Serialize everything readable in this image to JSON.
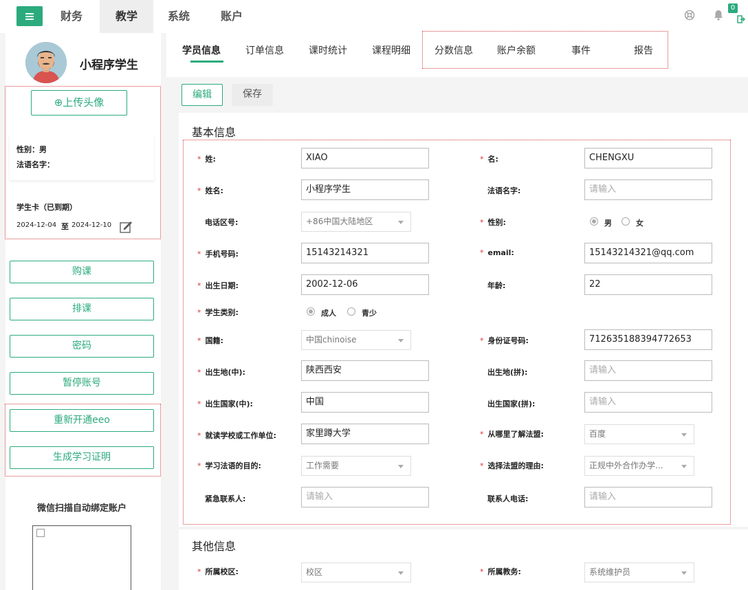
{
  "nav": {
    "items": [
      "财务",
      "教学",
      "系统",
      "账户"
    ],
    "active": "教学",
    "badge_count": "0"
  },
  "student": {
    "name": "小程序学生"
  },
  "sidebar": {
    "upload_label": "⊕上传头像",
    "gender_line": "性别：男",
    "french_name_line": "法语名字：",
    "card_title": "学生卡（已到期）",
    "card_start": "2024-12-04",
    "card_to": "至",
    "card_end": "2024-12-10",
    "buttons": [
      "购课",
      "排课",
      "密码",
      "暂停账号",
      "重新开通eeo",
      "生成学习证明"
    ],
    "wechat_title": "微信扫描自动绑定账户"
  },
  "tabs": [
    "学员信息",
    "订单信息",
    "课时统计",
    "课程明细",
    "分数信息",
    "账户余额",
    "事件",
    "报告"
  ],
  "actions": {
    "edit": "编辑",
    "save": "保存"
  },
  "basic": {
    "title": "基本信息",
    "fields": {
      "last_name": {
        "label": "姓:",
        "value": "XIAO"
      },
      "first_name": {
        "label": "名:",
        "value": "CHENGXU"
      },
      "full_name": {
        "label": "姓名:",
        "value": "小程序学生"
      },
      "french_name": {
        "label": "法语名字:",
        "placeholder": "请输入"
      },
      "phone_code": {
        "label": "电话区号:",
        "value": "+86中国大陆地区"
      },
      "gender": {
        "label": "性别:",
        "opt_male": "男",
        "opt_female": "女"
      },
      "mobile": {
        "label": "手机号码:",
        "value": "15143214321"
      },
      "email": {
        "label": "email:",
        "value": "15143214321@qq.com"
      },
      "birth": {
        "label": "出生日期:",
        "value": "2002-12-06"
      },
      "age": {
        "label": "年龄:",
        "value": "22"
      },
      "category": {
        "label": "学生类别:",
        "opt_adult": "成人",
        "opt_youth": "青少"
      },
      "nationality": {
        "label": "国籍:",
        "value": "中国chinoise"
      },
      "id_no": {
        "label": "身份证号码:",
        "value": "712635188394772653"
      },
      "birthplace_cn": {
        "label": "出生地(中):",
        "value": "陕西西安"
      },
      "birthplace_py": {
        "label": "出生地(拼):",
        "placeholder": "请输入"
      },
      "country_cn": {
        "label": "出生国家(中):",
        "value": "中国"
      },
      "country_py": {
        "label": "出生国家(拼):",
        "placeholder": "请输入"
      },
      "school": {
        "label": "就读学校或工作单位:",
        "value": "家里蹲大学"
      },
      "source": {
        "label": "从哪里了解法盟:",
        "value": "百度"
      },
      "purpose": {
        "label": "学习法语的目的:",
        "value": "工作需要"
      },
      "reason": {
        "label": "选择法盟的理由:",
        "value": "正规中外合作办学..."
      },
      "emergency": {
        "label": "紧急联系人:",
        "placeholder": "请输入"
      },
      "contact_phone": {
        "label": "联系人电话:",
        "placeholder": "请输入"
      }
    }
  },
  "other": {
    "title": "其他信息",
    "campus": {
      "label": "所属校区:",
      "value": "校区"
    },
    "staff": {
      "label": "所属教务:",
      "value": "系统维护员"
    }
  },
  "colors": {
    "accent": "#2bab7d",
    "required": "#d9363e",
    "highlight_border": "#d43c3c"
  }
}
